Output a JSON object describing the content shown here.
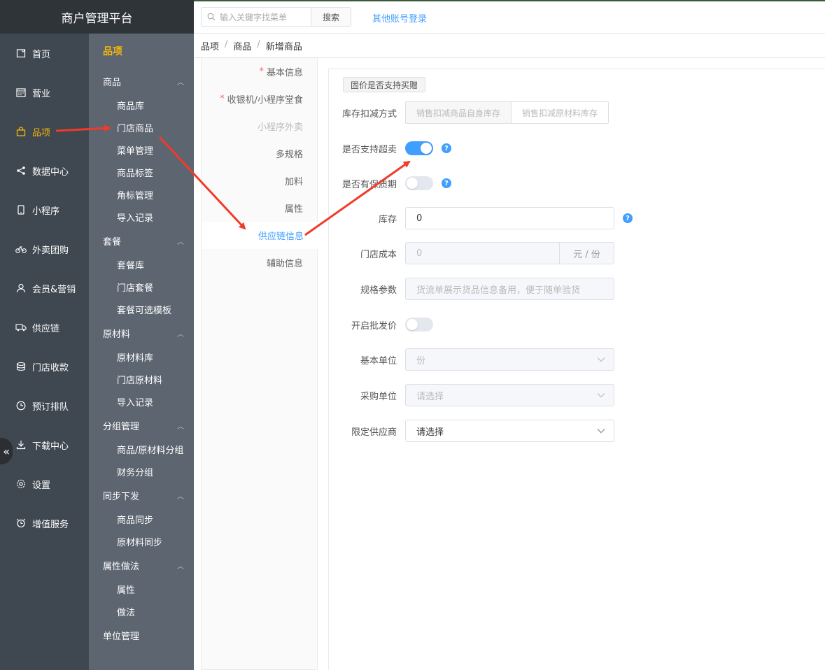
{
  "app": {
    "title": "商户管理平台"
  },
  "nav": [
    {
      "label": "首页",
      "icon": "home-icon",
      "active": false
    },
    {
      "label": "营业",
      "icon": "calendar-icon",
      "active": false
    },
    {
      "label": "品项",
      "icon": "bag-icon",
      "active": true
    },
    {
      "label": "数据中心",
      "icon": "share-icon",
      "active": false
    },
    {
      "label": "小程序",
      "icon": "phone-icon",
      "active": false
    },
    {
      "label": "外卖团购",
      "icon": "bike-icon",
      "active": false
    },
    {
      "label": "会员&营销",
      "icon": "user-icon",
      "active": false
    },
    {
      "label": "供应链",
      "icon": "truck-icon",
      "active": false
    },
    {
      "label": "门店收款",
      "icon": "coins-icon",
      "active": false
    },
    {
      "label": "预订排队",
      "icon": "clock-icon",
      "active": false
    },
    {
      "label": "下载中心",
      "icon": "download-icon",
      "active": false
    },
    {
      "label": "设置",
      "icon": "gear-icon",
      "active": false
    },
    {
      "label": "增值服务",
      "icon": "alarm-icon",
      "active": false
    }
  ],
  "subbar": {
    "title": "品项",
    "groups": [
      {
        "label": "商品",
        "items": [
          "商品库",
          "门店商品",
          "菜单管理",
          "商品标签",
          "角标管理",
          "导入记录"
        ]
      },
      {
        "label": "套餐",
        "items": [
          "套餐库",
          "门店套餐",
          "套餐可选模板"
        ]
      },
      {
        "label": "原材料",
        "items": [
          "原材料库",
          "门店原材料",
          "导入记录"
        ]
      },
      {
        "label": "分组管理",
        "items": [
          "商品/原材料分组",
          "财务分组"
        ]
      },
      {
        "label": "同步下发",
        "items": [
          "商品同步",
          "原材料同步"
        ]
      },
      {
        "label": "属性做法",
        "items": [
          "属性",
          "做法"
        ]
      },
      {
        "label": "单位管理",
        "items": []
      }
    ]
  },
  "topbar": {
    "search_placeholder": "输入关键字找菜单",
    "search_button": "搜索",
    "other_login": "其他账号登录"
  },
  "breadcrumb": [
    "品项",
    "商品",
    "新增商品"
  ],
  "steps": [
    {
      "label": "基本信息",
      "required": true,
      "state": "normal"
    },
    {
      "label": "收银机/小程序堂食",
      "required": true,
      "state": "normal"
    },
    {
      "label": "小程序外卖",
      "required": false,
      "state": "disabled"
    },
    {
      "label": "多规格",
      "required": false,
      "state": "normal"
    },
    {
      "label": "加料",
      "required": false,
      "state": "normal"
    },
    {
      "label": "属性",
      "required": false,
      "state": "normal"
    },
    {
      "label": "供应链信息",
      "required": false,
      "state": "active"
    },
    {
      "label": "辅助信息",
      "required": false,
      "state": "normal"
    }
  ],
  "form": {
    "tag_button": "固价是否支持买赠",
    "stock_mode": {
      "label": "库存扣减方式",
      "options": [
        "销售扣减商品自身库存",
        "销售扣减原材料库存"
      ]
    },
    "oversell": {
      "label": "是否支持超卖",
      "on": true
    },
    "shelf_life": {
      "label": "是否有保质期",
      "on": false
    },
    "stock": {
      "label": "库存",
      "value": "0"
    },
    "cost": {
      "label": "门店成本",
      "value": "0",
      "suffix": "元 / 份"
    },
    "spec": {
      "label": "规格参数",
      "placeholder": "货流单展示货品信息备用，便于随单验货"
    },
    "wholesale": {
      "label": "开启批发价",
      "on": false
    },
    "base_unit": {
      "label": "基本单位",
      "value": "份"
    },
    "purchase_unit": {
      "label": "采购单位",
      "value": "请选择"
    },
    "supplier": {
      "label": "限定供应商",
      "value": "请选择"
    }
  },
  "colors": {
    "accent": "#409eff",
    "active_nav": "#f5b60a",
    "arrow": "#f23a2a"
  }
}
